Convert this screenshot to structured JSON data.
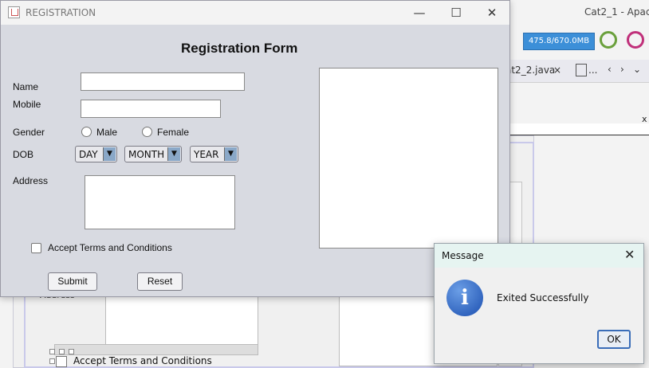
{
  "ide": {
    "title": "Cat2_1 - Apach",
    "memory": "475.8/670.0MB",
    "tab_label": "at2_2.java",
    "tab_close": "×",
    "overflow": "...",
    "panel_close": "x",
    "bg_address": "Address",
    "bg_accept": "Accept Terms and Conditions"
  },
  "window": {
    "title": "REGISTRATION",
    "minimize": "—",
    "maximize": "☐",
    "close": "✕"
  },
  "form": {
    "heading": "Registration Form",
    "name_label": "Name",
    "name_value": "",
    "mobile_label": "Mobile",
    "mobile_value": "",
    "gender_label": "Gender",
    "gender_options": [
      "Male",
      "Female"
    ],
    "dob_label": "DOB",
    "dob_day": "DAY",
    "dob_month": "MONTH",
    "dob_year": "YEAR",
    "combo_arrow": "▼",
    "address_label": "Address",
    "accept_label": "Accept Terms and Conditions",
    "submit": "Submit",
    "reset": "Reset"
  },
  "dialog": {
    "title": "Message",
    "close": "✕",
    "icon": "i",
    "message": "Exited Successfully",
    "ok": "OK"
  },
  "colors": {
    "memory_bar": "#3c8fd8",
    "window_bg": "#d8dae1",
    "dialog_titlebar": "#e6f4f1",
    "ok_border": "#3a6db8"
  }
}
